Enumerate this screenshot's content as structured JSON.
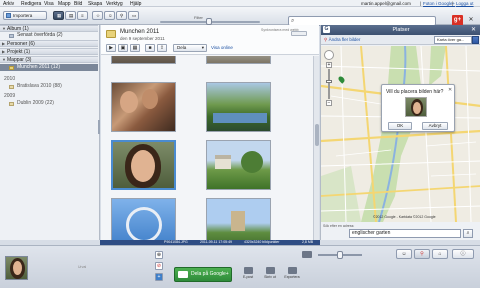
{
  "menubar": {
    "items": [
      "Arkiv",
      "Redigera",
      "Visa",
      "Mapp",
      "Bild",
      "Skapa",
      "Verktyg",
      "Hjälp"
    ],
    "account_email": "martin.appel@gmail.com",
    "account_links": [
      "Foton i Google+",
      "Logga ut"
    ]
  },
  "toolbar": {
    "import_label": "Importera",
    "filter_label": "Filter",
    "search_placeholder": ""
  },
  "sidebar": {
    "sections": [
      {
        "label": "Album (1)"
      },
      {
        "label": "Personer (6)"
      },
      {
        "label": "Projekt (1)"
      },
      {
        "label": "Mappar (3)"
      }
    ],
    "album_items": [
      {
        "label": "Senast överförda (2)"
      }
    ],
    "folder_items": [
      {
        "label": "Munchen 2011 (12)"
      }
    ],
    "years": [
      {
        "year": "2010",
        "items": [
          {
            "label": "Bratislava 2010 (88)"
          }
        ]
      },
      {
        "year": "2009",
        "items": [
          {
            "label": "Dublin 2009 (22)"
          }
        ]
      }
    ]
  },
  "album": {
    "title": "Munchen 2011",
    "date": "den 9 september 2011",
    "sub_label": "Synkronisera med webb",
    "share_label": "Dela",
    "view_online_label": "Visa online"
  },
  "status": {
    "filename": "P9041084.JPG",
    "datetime": "2011-09-11 17:05:49",
    "dimensions": "4320x3240 bildpunkter",
    "size": "2,8 MB"
  },
  "places": {
    "title": "Platser",
    "back_label": "Ändra fler bilder",
    "map_type": "Karta över ga...",
    "bubble_question": "Vill du placera bilden här?",
    "ok_label": "OK",
    "cancel_label": "Avbryt",
    "copyright": "©2012 Google - Kartdata ©2012 Google",
    "search_label": "Sök efter en adress:",
    "search_value": "englischer garten"
  },
  "bottom": {
    "tray_label": "Urval",
    "google_button": "Dela på Google+",
    "actions": [
      {
        "label": "E-post"
      },
      {
        "label": "Skriv ut"
      },
      {
        "label": "Exportera"
      }
    ]
  },
  "colors": {
    "accent": "#2f4d84",
    "selection": "#7b8799",
    "google_green": "#2e8b3a",
    "map_bg": "#efece3"
  }
}
